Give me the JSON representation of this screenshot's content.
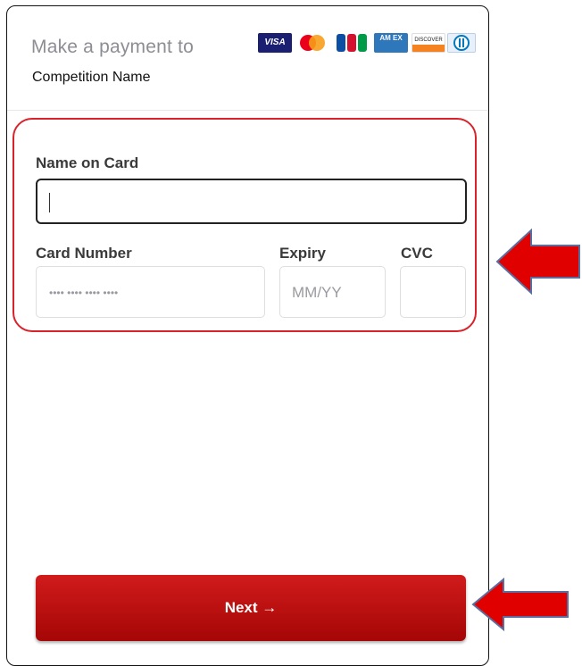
{
  "payment": {
    "title": "Make a payment to",
    "recipient": "Competition Name"
  },
  "accepted_cards": [
    "visa",
    "mastercard",
    "jcb",
    "amex",
    "discover",
    "diners"
  ],
  "card_labels": {
    "visa": "VISA",
    "discover": "DISCOVER",
    "amex": "AM EX"
  },
  "form": {
    "name_label": "Name on Card",
    "name_value": "",
    "number_label": "Card Number",
    "number_placeholder": "•••• •••• •••• ••••",
    "expiry_label": "Expiry",
    "expiry_placeholder": "MM/YY",
    "cvc_label": "CVC",
    "cvc_value": ""
  },
  "next_button": {
    "label": "Next →"
  },
  "colors": {
    "accent": "#c10e0e",
    "highlight": "#d8232a",
    "annotation_arrow": "#e00000"
  }
}
